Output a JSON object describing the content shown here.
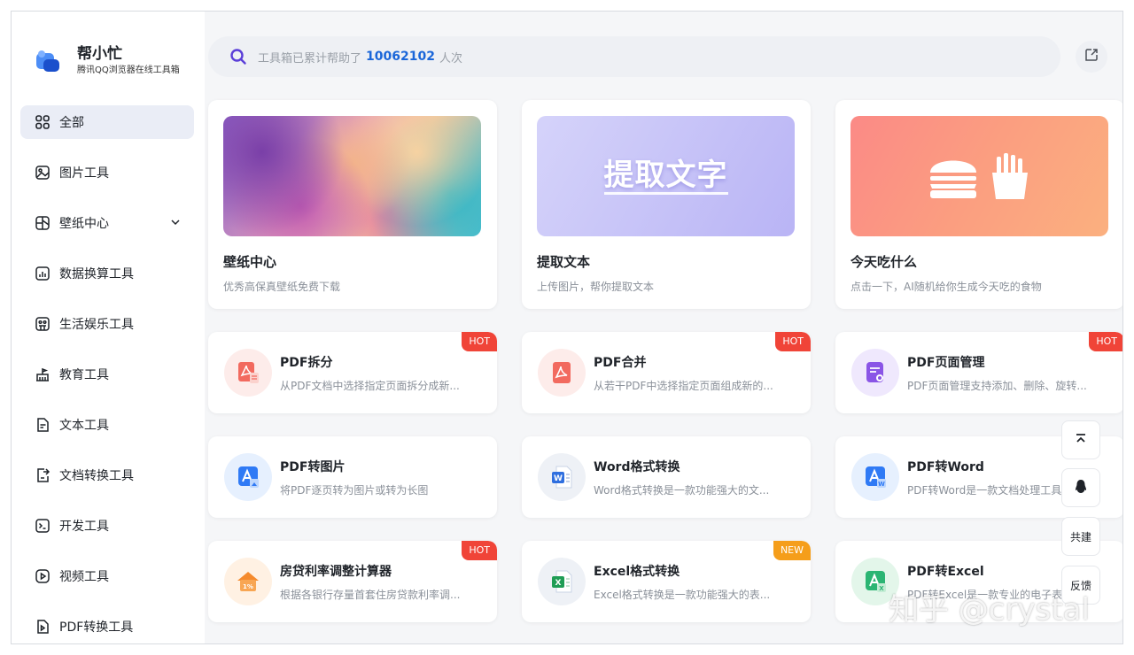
{
  "brand": {
    "title": "帮小忙",
    "subtitle": "腾讯QQ浏览器在线工具箱"
  },
  "sidebar": {
    "items": [
      {
        "label": "全部",
        "icon": "grid-icon",
        "active": true
      },
      {
        "label": "图片工具",
        "icon": "image-icon"
      },
      {
        "label": "壁纸中心",
        "icon": "wallpaper-icon",
        "expandable": true
      },
      {
        "label": "数据换算工具",
        "icon": "chart-icon"
      },
      {
        "label": "生活娱乐工具",
        "icon": "game-icon"
      },
      {
        "label": "教育工具",
        "icon": "school-icon"
      },
      {
        "label": "文本工具",
        "icon": "text-doc-icon"
      },
      {
        "label": "文档转换工具",
        "icon": "doc-convert-icon"
      },
      {
        "label": "开发工具",
        "icon": "terminal-icon"
      },
      {
        "label": "视频工具",
        "icon": "video-icon"
      },
      {
        "label": "PDF转换工具",
        "icon": "pdf-convert-icon"
      }
    ]
  },
  "search": {
    "prefix": "工具箱已累计帮助了",
    "count": "10062102",
    "suffix": "人次"
  },
  "featured": [
    {
      "title": "壁纸中心",
      "desc": "优秀高保真壁纸免费下载"
    },
    {
      "title": "提取文本",
      "desc": "上传图片，帮你提取文本",
      "image_text": "提取文字"
    },
    {
      "title": "今天吃什么",
      "desc": "点击一下，AI随机给你生成今天吃的食物"
    }
  ],
  "tools": [
    {
      "title": "PDF拆分",
      "desc": "从PDF文档中选择指定页面拆分成新...",
      "badge": "HOT",
      "icon": "pdf-split-icon"
    },
    {
      "title": "PDF合并",
      "desc": "从若干PDF中选择指定页面组成新的...",
      "badge": "HOT",
      "icon": "pdf-merge-icon"
    },
    {
      "title": "PDF页面管理",
      "desc": "PDF页面管理支持添加、删除、旋转...",
      "badge": "HOT",
      "icon": "pdf-pages-icon"
    },
    {
      "title": "PDF转图片",
      "desc": "将PDF逐页转为图片或转为长图",
      "badge": "",
      "icon": "pdf-to-image-icon"
    },
    {
      "title": "Word格式转换",
      "desc": "Word格式转换是一款功能强大的文...",
      "badge": "",
      "icon": "word-icon"
    },
    {
      "title": "PDF转Word",
      "desc": "PDF转Word是一款文档处理工具...",
      "badge": "",
      "icon": "pdf-to-word-icon"
    },
    {
      "title": "房贷利率调整计算器",
      "desc": "根据各银行存量首套住房贷款利率调...",
      "badge": "HOT",
      "icon": "house-icon"
    },
    {
      "title": "Excel格式转换",
      "desc": "Excel格式转换是一款功能强大的表...",
      "badge": "NEW",
      "icon": "excel-icon"
    },
    {
      "title": "PDF转Excel",
      "desc": "PDF转Excel是一款专业的电子表...",
      "badge": "",
      "icon": "pdf-to-excel-icon"
    }
  ],
  "float_tools": {
    "top": "back-to-top-icon",
    "qq": "qq-icon",
    "cobuild": "共建",
    "feedback": "反馈"
  },
  "watermark": "知乎 @crystal",
  "colors": {
    "accent": "#1a66d9",
    "hot": "#f04438",
    "new": "#f59e1b",
    "active_bg": "#eaedf6"
  }
}
